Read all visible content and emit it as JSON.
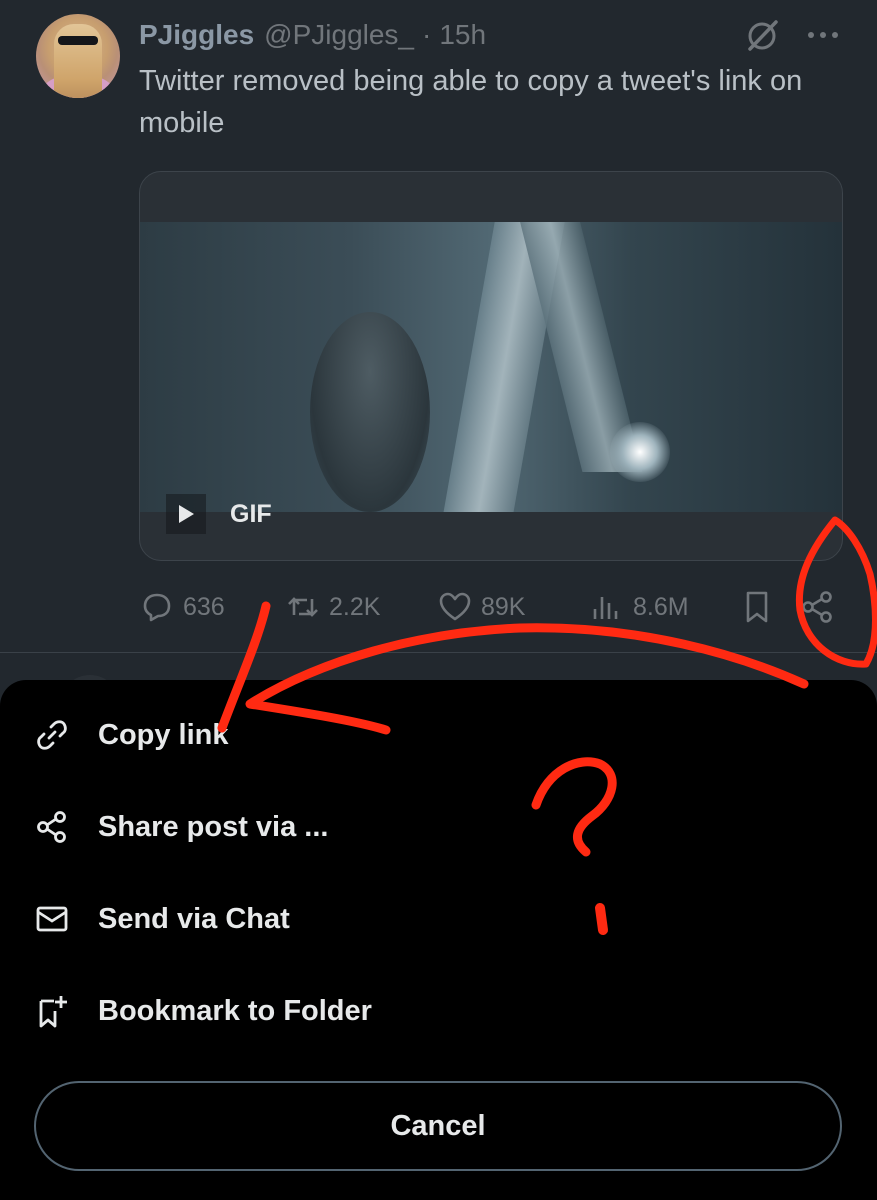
{
  "tweet": {
    "display_name": "PJiggles",
    "handle": "@PJiggles_",
    "separator": "·",
    "time": "15h",
    "text": "Twitter removed being able to copy a tweet's link on mobile",
    "media": {
      "badge_label": "GIF"
    },
    "actions": {
      "replies": "636",
      "reposts": "2.2K",
      "likes": "89K",
      "views": "8.6M"
    }
  },
  "share_sheet": {
    "items": [
      {
        "label": "Copy link",
        "icon": "link-icon"
      },
      {
        "label": "Share post via ...",
        "icon": "share-icon"
      },
      {
        "label": "Send via Chat",
        "icon": "envelope-icon"
      },
      {
        "label": "Bookmark to Folder",
        "icon": "bookmark-add-icon"
      }
    ],
    "cancel_label": "Cancel"
  },
  "colors": {
    "background": "#22282e",
    "sheet_background": "#000000",
    "annotation_red": "#ff2a12",
    "muted_text": "#71767b"
  }
}
